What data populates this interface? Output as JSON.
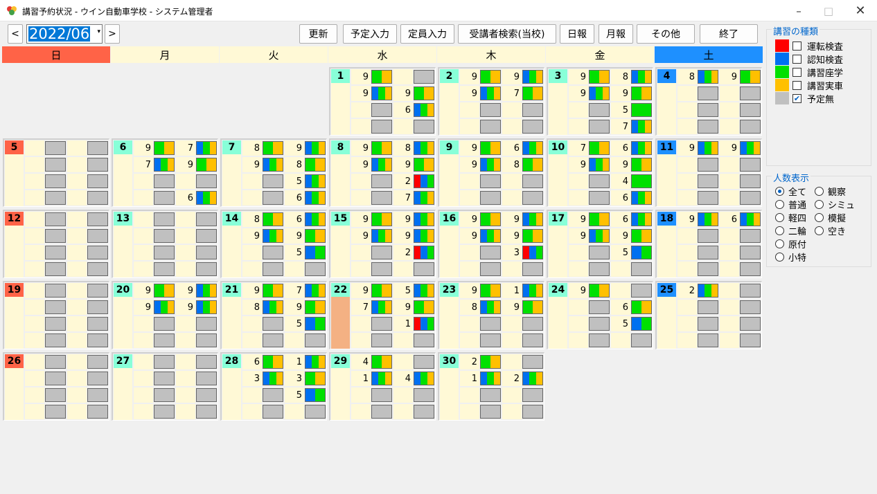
{
  "window": {
    "title": "講習予約状況 - ウイン自動車学校 - システム管理者"
  },
  "toolbar": {
    "prev": "<",
    "next": ">",
    "month": "2022/06",
    "dropdown": "▾",
    "buttons": [
      "更新",
      "予定入力",
      "定員入力",
      "受講者検索(当校)",
      "日報",
      "月報",
      "その他",
      "終了"
    ]
  },
  "weekdays": [
    "日",
    "月",
    "火",
    "水",
    "木",
    "金",
    "土"
  ],
  "colors": {
    "red": "#ff0000",
    "blue": "#0070f0",
    "green": "#00e000",
    "yellow": "#ffc000",
    "gray": "#c0c0c0",
    "sun": "#ff6347",
    "sat": "#1e90ff",
    "weekday": "#fff9d6",
    "daynum": "#88ffd8",
    "today": "#f4b183"
  },
  "legend": {
    "title": "講習の種類",
    "items": [
      {
        "label": "運転検査",
        "color": "#ff0000",
        "checked": false
      },
      {
        "label": "認知検査",
        "color": "#0070f0",
        "checked": false
      },
      {
        "label": "講習座学",
        "color": "#00e000",
        "checked": false
      },
      {
        "label": "講習実車",
        "color": "#ffc000",
        "checked": false
      },
      {
        "label": "予定無",
        "color": "#c0c0c0",
        "checked": true
      }
    ]
  },
  "people": {
    "title": "人数表示",
    "options": [
      {
        "label": "全て",
        "selected": true
      },
      {
        "label": "観察",
        "selected": false
      },
      {
        "label": "普通",
        "selected": false
      },
      {
        "label": "シミュ",
        "selected": false
      },
      {
        "label": "軽四",
        "selected": false
      },
      {
        "label": "模擬",
        "selected": false
      },
      {
        "label": "二輪",
        "selected": false
      },
      {
        "label": "空き",
        "selected": false
      },
      {
        "label": "原付",
        "selected": false
      },
      {
        "label": "小特",
        "selected": false
      }
    ]
  },
  "days": [
    {
      "d": "1",
      "wd": 3,
      "wk": 0,
      "slots": [
        [
          "9",
          "gy"
        ],
        [
          "",
          "x"
        ],
        [
          "9",
          "bgy"
        ],
        [
          "9",
          "gy"
        ],
        [
          "",
          "x"
        ],
        [
          "6",
          "bgy"
        ],
        [
          "",
          "x"
        ],
        [
          "",
          "x"
        ]
      ]
    },
    {
      "d": "2",
      "wd": 4,
      "wk": 0,
      "slots": [
        [
          "9",
          "gy"
        ],
        [
          "9",
          "bgy"
        ],
        [
          "9",
          "bgy"
        ],
        [
          "7",
          "gy"
        ],
        [
          "",
          "x"
        ],
        [
          "",
          "x"
        ],
        [
          "",
          "x"
        ],
        [
          "",
          "x"
        ]
      ]
    },
    {
      "d": "3",
      "wd": 5,
      "wk": 0,
      "slots": [
        [
          "9",
          "gy"
        ],
        [
          "8",
          "bgy"
        ],
        [
          "9",
          "bgy"
        ],
        [
          "9",
          "gy"
        ],
        [
          "",
          "x"
        ],
        [
          "5",
          "g"
        ],
        [
          "",
          "x"
        ],
        [
          "7",
          "bgy"
        ]
      ]
    },
    {
      "d": "4",
      "wd": 6,
      "wk": 0,
      "slots": [
        [
          "8",
          "bgy"
        ],
        [
          "9",
          "gy"
        ],
        [
          "",
          "x"
        ],
        [
          "",
          "x"
        ],
        [
          "",
          "x"
        ],
        [
          "",
          "x"
        ],
        [
          "",
          "x"
        ],
        [
          "",
          "x"
        ]
      ]
    },
    {
      "d": "5",
      "wd": 0,
      "wk": 1,
      "slots": [
        [
          "",
          "x"
        ],
        [
          "",
          "x"
        ],
        [
          "",
          "x"
        ],
        [
          "",
          "x"
        ],
        [
          "",
          "x"
        ],
        [
          "",
          "x"
        ],
        [
          "",
          "x"
        ],
        [
          "",
          "x"
        ]
      ]
    },
    {
      "d": "6",
      "wd": 1,
      "wk": 1,
      "slots": [
        [
          "9",
          "gy"
        ],
        [
          "7",
          "bgy"
        ],
        [
          "7",
          "bgy"
        ],
        [
          "9",
          "gy"
        ],
        [
          "",
          "x"
        ],
        [
          "",
          "x"
        ],
        [
          "",
          "x"
        ],
        [
          "6",
          "bgy"
        ]
      ]
    },
    {
      "d": "7",
      "wd": 2,
      "wk": 1,
      "slots": [
        [
          "8",
          "gy"
        ],
        [
          "9",
          "bgy"
        ],
        [
          "9",
          "bgy"
        ],
        [
          "8",
          "gy"
        ],
        [
          "",
          "x"
        ],
        [
          "5",
          "bgy"
        ],
        [
          "",
          "x"
        ],
        [
          "6",
          "bgy"
        ]
      ]
    },
    {
      "d": "8",
      "wd": 3,
      "wk": 1,
      "slots": [
        [
          "9",
          "gy"
        ],
        [
          "8",
          "bgy"
        ],
        [
          "9",
          "bgy"
        ],
        [
          "9",
          "gy"
        ],
        [
          "",
          "x"
        ],
        [
          "2",
          "rbg"
        ],
        [
          "",
          "x"
        ],
        [
          "7",
          "bgy"
        ]
      ]
    },
    {
      "d": "9",
      "wd": 4,
      "wk": 1,
      "slots": [
        [
          "9",
          "gy"
        ],
        [
          "6",
          "bgy"
        ],
        [
          "9",
          "bgy"
        ],
        [
          "8",
          "gy"
        ],
        [
          "",
          "x"
        ],
        [
          "",
          "x"
        ],
        [
          "",
          "x"
        ],
        [
          "",
          "x"
        ]
      ]
    },
    {
      "d": "10",
      "wd": 5,
      "wk": 1,
      "slots": [
        [
          "7",
          "gy"
        ],
        [
          "6",
          "bgy"
        ],
        [
          "9",
          "bgy"
        ],
        [
          "9",
          "gy"
        ],
        [
          "",
          "x"
        ],
        [
          "4",
          "g"
        ],
        [
          "",
          "x"
        ],
        [
          "6",
          "bgy"
        ]
      ]
    },
    {
      "d": "11",
      "wd": 6,
      "wk": 1,
      "slots": [
        [
          "9",
          "bgy"
        ],
        [
          "9",
          "bgy"
        ],
        [
          "",
          "x"
        ],
        [
          "",
          "x"
        ],
        [
          "",
          "x"
        ],
        [
          "",
          "x"
        ],
        [
          "",
          "x"
        ],
        [
          "",
          "x"
        ]
      ]
    },
    {
      "d": "12",
      "wd": 0,
      "wk": 2,
      "slots": [
        [
          "",
          "x"
        ],
        [
          "",
          "x"
        ],
        [
          "",
          "x"
        ],
        [
          "",
          "x"
        ],
        [
          "",
          "x"
        ],
        [
          "",
          "x"
        ],
        [
          "",
          "x"
        ],
        [
          "",
          "x"
        ]
      ]
    },
    {
      "d": "13",
      "wd": 1,
      "wk": 2,
      "slots": [
        [
          "",
          "x"
        ],
        [
          "",
          "x"
        ],
        [
          "",
          "x"
        ],
        [
          "",
          "x"
        ],
        [
          "",
          "x"
        ],
        [
          "",
          "x"
        ],
        [
          "",
          "x"
        ],
        [
          "",
          "x"
        ]
      ]
    },
    {
      "d": "14",
      "wd": 2,
      "wk": 2,
      "slots": [
        [
          "8",
          "gy"
        ],
        [
          "6",
          "bgy"
        ],
        [
          "9",
          "bgy"
        ],
        [
          "9",
          "gy"
        ],
        [
          "",
          "x"
        ],
        [
          "5",
          "bg"
        ],
        [
          "",
          "x"
        ],
        [
          "",
          "x"
        ]
      ]
    },
    {
      "d": "15",
      "wd": 3,
      "wk": 2,
      "slots": [
        [
          "9",
          "gy"
        ],
        [
          "9",
          "bgy"
        ],
        [
          "9",
          "bgy"
        ],
        [
          "9",
          "bgy"
        ],
        [
          "",
          "x"
        ],
        [
          "2",
          "rbg"
        ],
        [
          "",
          "x"
        ],
        [
          "",
          "x"
        ]
      ]
    },
    {
      "d": "16",
      "wd": 4,
      "wk": 2,
      "slots": [
        [
          "9",
          "gy"
        ],
        [
          "9",
          "bgy"
        ],
        [
          "9",
          "bgy"
        ],
        [
          "9",
          "gy"
        ],
        [
          "",
          "x"
        ],
        [
          "3",
          "rbg"
        ],
        [
          "",
          "x"
        ],
        [
          "",
          "x"
        ]
      ]
    },
    {
      "d": "17",
      "wd": 5,
      "wk": 2,
      "slots": [
        [
          "9",
          "gy"
        ],
        [
          "6",
          "bgy"
        ],
        [
          "9",
          "bgy"
        ],
        [
          "9",
          "gy"
        ],
        [
          "",
          "x"
        ],
        [
          "5",
          "bg"
        ],
        [
          "",
          "x"
        ],
        [
          "",
          "x"
        ]
      ]
    },
    {
      "d": "18",
      "wd": 6,
      "wk": 2,
      "slots": [
        [
          "9",
          "bgy"
        ],
        [
          "6",
          "bgy"
        ],
        [
          "",
          "x"
        ],
        [
          "",
          "x"
        ],
        [
          "",
          "x"
        ],
        [
          "",
          "x"
        ],
        [
          "",
          "x"
        ],
        [
          "",
          "x"
        ]
      ]
    },
    {
      "d": "19",
      "wd": 0,
      "wk": 3,
      "slots": [
        [
          "",
          "x"
        ],
        [
          "",
          "x"
        ],
        [
          "",
          "x"
        ],
        [
          "",
          "x"
        ],
        [
          "",
          "x"
        ],
        [
          "",
          "x"
        ],
        [
          "",
          "x"
        ],
        [
          "",
          "x"
        ]
      ]
    },
    {
      "d": "20",
      "wd": 1,
      "wk": 3,
      "slots": [
        [
          "9",
          "gy"
        ],
        [
          "9",
          "bgy"
        ],
        [
          "9",
          "bgy"
        ],
        [
          "9",
          "bgy"
        ],
        [
          "",
          "x"
        ],
        [
          "",
          "x"
        ],
        [
          "",
          "x"
        ],
        [
          "",
          "x"
        ]
      ]
    },
    {
      "d": "21",
      "wd": 2,
      "wk": 3,
      "slots": [
        [
          "9",
          "gy"
        ],
        [
          "7",
          "bgy"
        ],
        [
          "8",
          "bgy"
        ],
        [
          "9",
          "gy"
        ],
        [
          "",
          "x"
        ],
        [
          "5",
          "bg"
        ],
        [
          "",
          "x"
        ],
        [
          "",
          "x"
        ]
      ]
    },
    {
      "d": "22",
      "wd": 3,
      "wk": 3,
      "today": true,
      "slots": [
        [
          "9",
          "gy"
        ],
        [
          "5",
          "bgy"
        ],
        [
          "7",
          "bgy"
        ],
        [
          "9",
          "gy"
        ],
        [
          "",
          "x"
        ],
        [
          "1",
          "rbg"
        ],
        [
          "",
          "x"
        ],
        [
          "",
          "x"
        ]
      ]
    },
    {
      "d": "23",
      "wd": 4,
      "wk": 3,
      "slots": [
        [
          "9",
          "gy"
        ],
        [
          "1",
          "bgy"
        ],
        [
          "8",
          "bgy"
        ],
        [
          "9",
          "gy"
        ],
        [
          "",
          "x"
        ],
        [
          "",
          "x"
        ],
        [
          "",
          "x"
        ],
        [
          "",
          "x"
        ]
      ]
    },
    {
      "d": "24",
      "wd": 5,
      "wk": 3,
      "slots": [
        [
          "9",
          "gy"
        ],
        [
          "",
          "x"
        ],
        [
          "",
          "x"
        ],
        [
          "6",
          "gy"
        ],
        [
          "",
          "x"
        ],
        [
          "5",
          "bg"
        ],
        [
          "",
          "x"
        ],
        [
          "",
          "x"
        ]
      ]
    },
    {
      "d": "25",
      "wd": 6,
      "wk": 3,
      "slots": [
        [
          "2",
          "bgy"
        ],
        [
          "",
          "x"
        ],
        [
          "",
          "x"
        ],
        [
          "",
          "x"
        ],
        [
          "",
          "x"
        ],
        [
          "",
          "x"
        ],
        [
          "",
          "x"
        ],
        [
          "",
          "x"
        ]
      ]
    },
    {
      "d": "26",
      "wd": 0,
      "wk": 4,
      "slots": [
        [
          "",
          "x"
        ],
        [
          "",
          "x"
        ],
        [
          "",
          "x"
        ],
        [
          "",
          "x"
        ],
        [
          "",
          "x"
        ],
        [
          "",
          "x"
        ],
        [
          "",
          "x"
        ],
        [
          "",
          "x"
        ]
      ]
    },
    {
      "d": "27",
      "wd": 1,
      "wk": 4,
      "slots": [
        [
          "",
          "x"
        ],
        [
          "",
          "x"
        ],
        [
          "",
          "x"
        ],
        [
          "",
          "x"
        ],
        [
          "",
          "x"
        ],
        [
          "",
          "x"
        ],
        [
          "",
          "x"
        ],
        [
          "",
          "x"
        ]
      ]
    },
    {
      "d": "28",
      "wd": 2,
      "wk": 4,
      "slots": [
        [
          "6",
          "gy"
        ],
        [
          "1",
          "bgy"
        ],
        [
          "3",
          "bgy"
        ],
        [
          "3",
          "gy"
        ],
        [
          "",
          "x"
        ],
        [
          "5",
          "bg"
        ],
        [
          "",
          "x"
        ],
        [
          "",
          "x"
        ]
      ]
    },
    {
      "d": "29",
      "wd": 3,
      "wk": 4,
      "slots": [
        [
          "4",
          "gy"
        ],
        [
          "",
          "x"
        ],
        [
          "1",
          "bgy"
        ],
        [
          "4",
          "bgy"
        ],
        [
          "",
          "x"
        ],
        [
          "",
          "x"
        ],
        [
          "",
          "x"
        ],
        [
          "",
          "x"
        ]
      ]
    },
    {
      "d": "30",
      "wd": 4,
      "wk": 4,
      "slots": [
        [
          "2",
          "gy"
        ],
        [
          "",
          "x"
        ],
        [
          "1",
          "bgy"
        ],
        [
          "2",
          "bgy"
        ],
        [
          "",
          "x"
        ],
        [
          "",
          "x"
        ],
        [
          "",
          "x"
        ],
        [
          "",
          "x"
        ]
      ]
    }
  ]
}
